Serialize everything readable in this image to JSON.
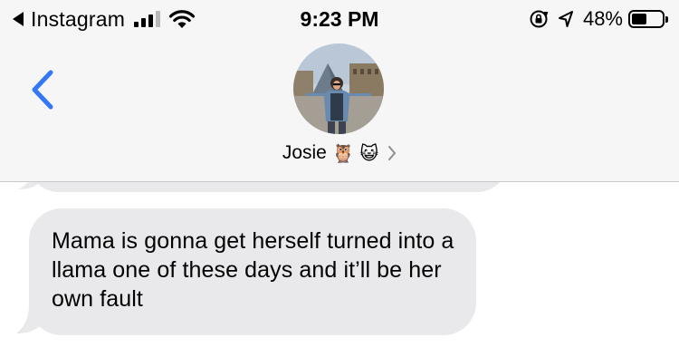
{
  "status_bar": {
    "back_app": "Instagram",
    "time": "9:23 PM",
    "battery_percent": "48%",
    "battery_level": 0.48,
    "signal_bars": 3
  },
  "header": {
    "contact_name": "Josie",
    "contact_emojis": "🦉 😺",
    "accent_color": "#3478f6"
  },
  "messages": [
    {
      "direction": "incoming",
      "text": "Mama is gonna get herself turned into a llama one of these days and it’ll be her own fault"
    }
  ],
  "colors": {
    "bar_background": "#f6f6f6",
    "incoming_bubble": "#e9e9eb"
  },
  "icons": [
    "back-triangle-icon",
    "signal-icon",
    "wifi-icon",
    "rotation-lock-icon",
    "location-arrow-icon",
    "battery-icon",
    "back-chevron-icon",
    "chevron-right-icon"
  ]
}
